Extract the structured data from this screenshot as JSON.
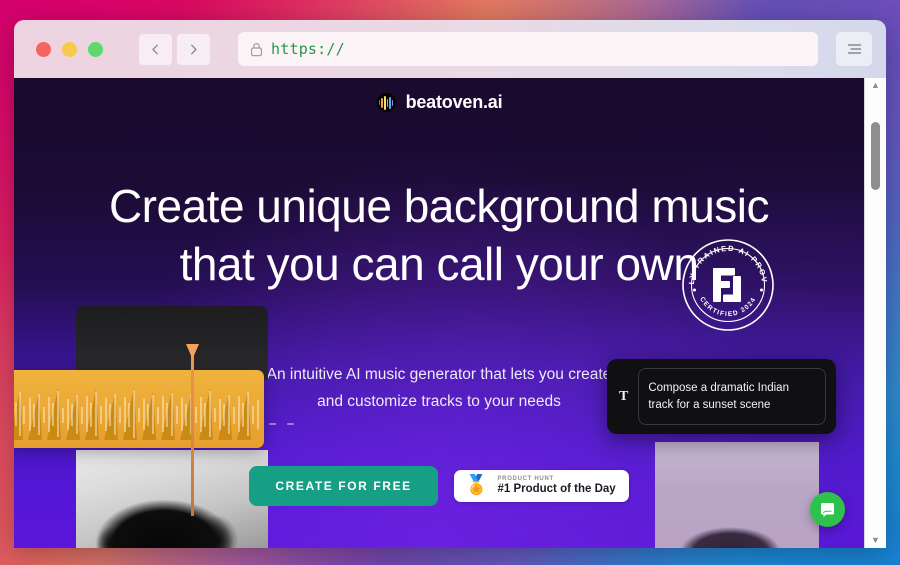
{
  "browser": {
    "window_controls": [
      {
        "name": "close",
        "color": "#f5655f"
      },
      {
        "name": "minimize",
        "color": "#f7ca4d"
      },
      {
        "name": "maximize",
        "color": "#5fd86e"
      }
    ],
    "back_label": "Back",
    "forward_label": "Forward",
    "url": "https://",
    "url_color": "#1f9a4a",
    "lock_icon": "lock-icon",
    "menu_icon": "hamburger-menu-icon",
    "scrollbar": {
      "up": "▲",
      "down": "▼"
    }
  },
  "site": {
    "brand_name": "beatoven.ai",
    "headline": "Create unique background music that you can call your own",
    "subheadline": "An intuitive AI music generator that lets you create and customize tracks to your needs",
    "badge": {
      "top_text": "FAIRLY TRAINED AI PROVIDER",
      "bottom_text": "CERTIFIED 2024",
      "monogram": "F"
    },
    "cta": {
      "primary_label": "CREATE FOR FREE",
      "primary_color": "#169f84"
    },
    "product_hunt": {
      "kicker": "PRODUCT HUNT",
      "title": "#1 Product of the Day",
      "medal_icon": "medal-icon"
    },
    "prompt": {
      "icon_label": "T",
      "text": "Compose a dramatic Indian track for a sunset scene"
    },
    "chat": {
      "icon": "chat-bubble-icon",
      "color": "#2ec24c"
    },
    "theme": {
      "page_top": "#190a2e",
      "page_bottom": "#5a16da",
      "waveform": "#f0b33d"
    }
  }
}
